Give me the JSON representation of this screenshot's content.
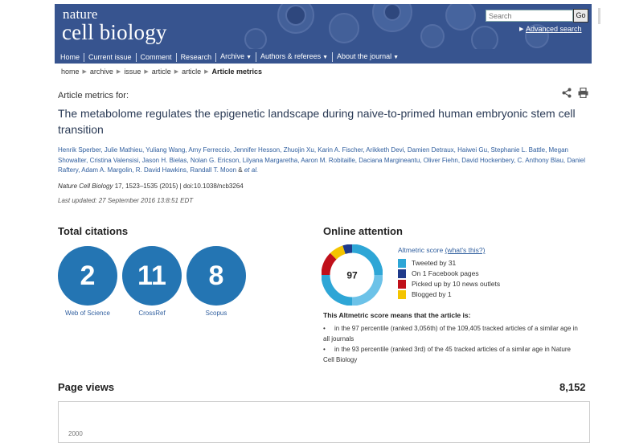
{
  "header": {
    "logo_line1": "nature",
    "logo_line2": "cell biology",
    "search_placeholder": "Search",
    "go_label": "Go",
    "advanced_search": "Advanced search",
    "nav": [
      {
        "label": "Home",
        "dropdown": false
      },
      {
        "label": "Current issue",
        "dropdown": false
      },
      {
        "label": "Comment",
        "dropdown": false
      },
      {
        "label": "Research",
        "dropdown": false
      },
      {
        "label": "Archive",
        "dropdown": true
      },
      {
        "label": "Authors & referees",
        "dropdown": true
      },
      {
        "label": "About the journal",
        "dropdown": true
      }
    ],
    "colors": {
      "header_bg": "#37548f"
    }
  },
  "breadcrumb": [
    "home",
    "archive",
    "issue",
    "article",
    "article",
    "Article metrics"
  ],
  "page": {
    "metrics_for": "Article metrics for:",
    "article_title": "The metabolome regulates the epigenetic landscape during naive-to-primed human embryonic stem cell transition",
    "authors": "Henrik Sperber, Julie Mathieu, Yuliang Wang, Amy Ferreccio, Jennifer Hesson, Zhuojin Xu, Karin A. Fischer, Arikketh Devi, Damien Detraux, Haiwei Gu, Stephanie L. Battle, Megan Showalter, Cristina Valensisi, Jason H. Bielas, Nolan G. Ericson, Lilyana Margaretha, Aaron M. Robitaille, Daciana Margineantu, Oliver Fiehn, David Hockenbery, C. Anthony Blau, Daniel Raftery, Adam A. Margolin, R. David Hawkins, Randall T. Moon",
    "et_al": "et al.",
    "citation_journal": "Nature Cell Biology",
    "citation_rest": "17, 1523–1535 (2015) | doi:10.1038/ncb3264",
    "last_updated": "Last updated: 27 September 2016 13:8:51 EDT"
  },
  "citations": {
    "title": "Total citations",
    "items": [
      {
        "value": "2",
        "label": "Web of Science"
      },
      {
        "value": "11",
        "label": "CrossRef"
      },
      {
        "value": "8",
        "label": "Scopus"
      }
    ],
    "circle_color": "#2475b3"
  },
  "attention": {
    "title": "Online attention",
    "score": "97",
    "score_label": "Altmetric score",
    "whats_this": "(what's this?)",
    "legend": [
      {
        "label": "Tweeted by 31",
        "color": "#2ea6d6"
      },
      {
        "label": "On 1 Facebook pages",
        "color": "#1f3a8a"
      },
      {
        "label": "Picked up by 10 news outlets",
        "color": "#c0101a"
      },
      {
        "label": "Blogged by 1",
        "color": "#f4c400"
      }
    ],
    "means_title": "This Altmetric score means that the article is:",
    "bullets": [
      "in the 97 percentile (ranked 3,056th) of the 109,405 tracked articles of a similar age in all journals",
      "in the 93 percentile (ranked 3rd) of the 45 tracked articles of a similar age in Nature Cell Biology"
    ]
  },
  "page_views": {
    "title": "Page views",
    "count": "8,152",
    "axis_tick": "2000"
  }
}
